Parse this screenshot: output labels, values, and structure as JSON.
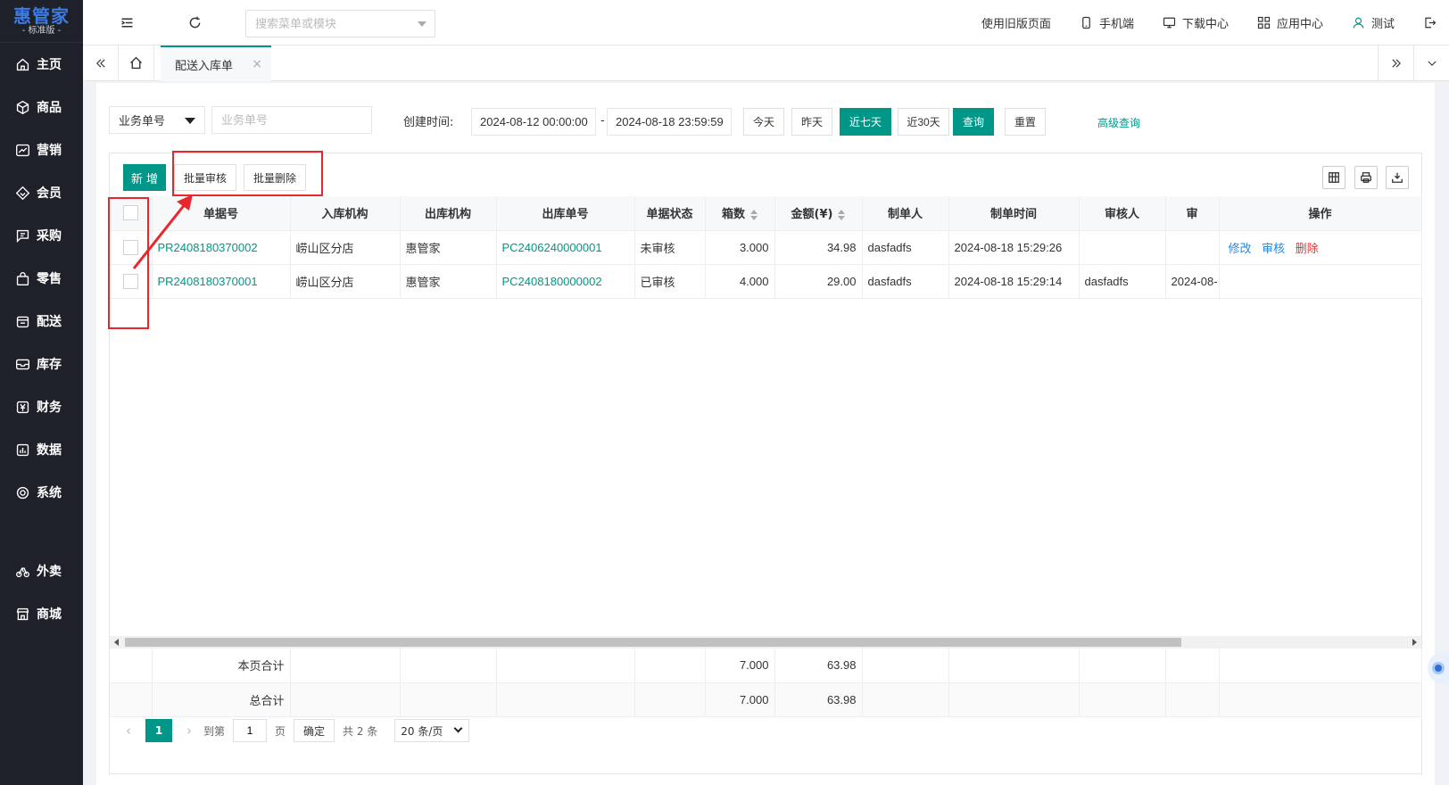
{
  "brand": {
    "name": "惠管家",
    "edition": "- 标准版 -"
  },
  "sidebar": {
    "items": [
      {
        "label": "主页",
        "icon": "home-icon"
      },
      {
        "label": "商品",
        "icon": "box-icon"
      },
      {
        "label": "营销",
        "icon": "trend-icon"
      },
      {
        "label": "会员",
        "icon": "diamond-icon"
      },
      {
        "label": "采购",
        "icon": "purchase-icon"
      },
      {
        "label": "零售",
        "icon": "bag-icon"
      },
      {
        "label": "配送",
        "icon": "delivery-icon"
      },
      {
        "label": "库存",
        "icon": "inventory-icon"
      },
      {
        "label": "财务",
        "icon": "yuan-icon"
      },
      {
        "label": "数据",
        "icon": "chart-icon"
      },
      {
        "label": "系统",
        "icon": "settings-icon"
      }
    ],
    "extra_items": [
      {
        "label": "外卖",
        "icon": "takeaway-icon"
      },
      {
        "label": "商城",
        "icon": "mall-icon"
      }
    ]
  },
  "topbar": {
    "search_placeholder": "搜索菜单或模块",
    "old_page": "使用旧版页面",
    "mobile": "手机端",
    "download": "下载中心",
    "apps": "应用中心",
    "user": "测试"
  },
  "tabs": {
    "active": "配送入库单",
    "close": "×"
  },
  "filters": {
    "field_select": "业务单号",
    "field_placeholder": "业务单号",
    "created_label": "创建时间:",
    "date_start": "2024-08-12 00:00:00",
    "date_sep": "-",
    "date_end": "2024-08-18 23:59:59",
    "btn_today": "今天",
    "btn_yesterday": "昨天",
    "btn_7days": "近七天",
    "btn_30days": "近30天",
    "btn_query": "查询",
    "btn_reset": "重置",
    "advanced": "高级查询"
  },
  "toolbar": {
    "add": "新 增",
    "batch_audit": "批量审核",
    "batch_delete": "批量删除"
  },
  "table": {
    "headers": [
      "单据号",
      "入库机构",
      "出库机构",
      "出库单号",
      "单据状态",
      "箱数",
      "金额(¥)",
      "制单人",
      "制单时间",
      "审核人",
      "审",
      "操作"
    ],
    "rows": [
      {
        "no": "PR2408180370002",
        "in_org": "崂山区分店",
        "out_org": "惠管家",
        "out_no": "PC2406240000001",
        "status": "未审核",
        "boxes": "3.000",
        "amount": "34.98",
        "maker": "dasfadfs",
        "made_at": "2024-08-18 15:29:26",
        "auditor": "",
        "audit_time": "",
        "op_edit": "修改",
        "op_audit": "审核",
        "op_delete": "删除"
      },
      {
        "no": "PR2408180370001",
        "in_org": "崂山区分店",
        "out_org": "惠管家",
        "out_no": "PC2408180000002",
        "status": "已审核",
        "boxes": "4.000",
        "amount": "29.00",
        "maker": "dasfadfs",
        "made_at": "2024-08-18 15:29:14",
        "auditor": "dasfadfs",
        "audit_time": "2024-08-",
        "op_edit": "",
        "op_audit": "",
        "op_delete": ""
      }
    ]
  },
  "totals": {
    "page_label": "本页合计",
    "page_boxes": "7.000",
    "page_amount": "63.98",
    "all_label": "总合计",
    "all_boxes": "7.000",
    "all_amount": "63.98"
  },
  "pager": {
    "current": "1",
    "goto_prefix": "到第",
    "goto_value": "1",
    "goto_suffix": "页",
    "confirm": "确定",
    "total": "共 2 条",
    "page_size": "20 条/页",
    "prev": "‹",
    "next": "›"
  },
  "colors": {
    "primary": "#009688",
    "sidebar_bg": "#1e2129",
    "annotation": "#e8262c",
    "link_blue": "#1e88e5",
    "danger": "#f03030"
  }
}
